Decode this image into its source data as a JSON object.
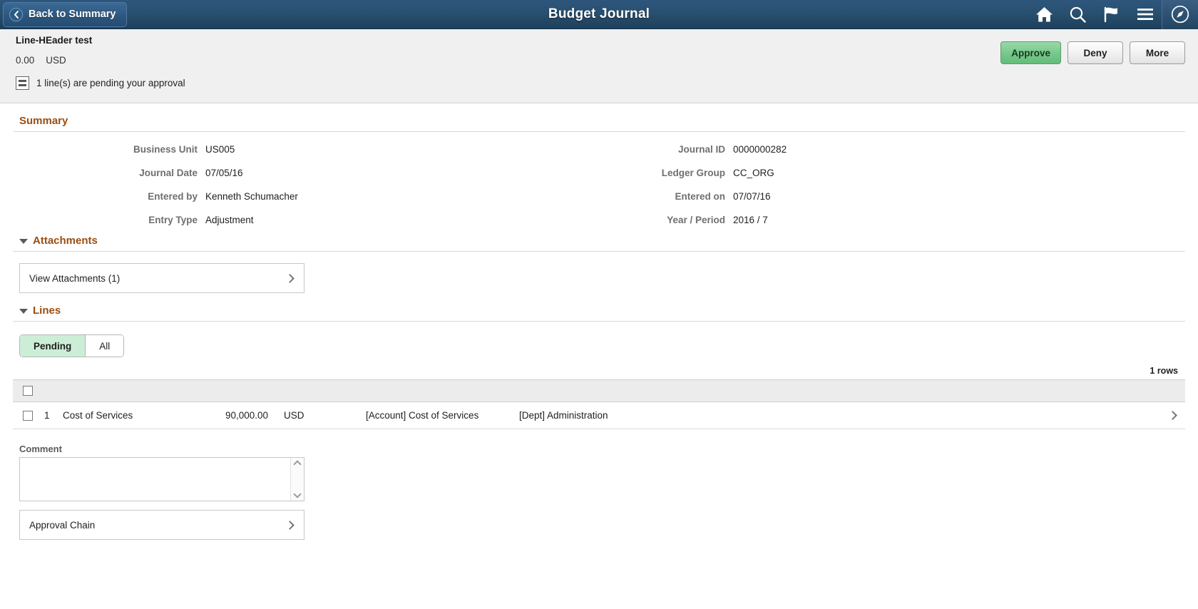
{
  "topbar": {
    "back_label": "Back to Summary",
    "title": "Budget Journal",
    "icons": [
      {
        "name": "home-icon",
        "label": "Home"
      },
      {
        "name": "search-icon",
        "label": "Search"
      },
      {
        "name": "flag-icon",
        "label": "Notifications"
      },
      {
        "name": "hamburger-menu-icon",
        "label": "Actions"
      },
      {
        "name": "navbar-compass-icon",
        "label": "NavBar"
      }
    ],
    "background_color": "#2b5279"
  },
  "subheader": {
    "doc_title": "Line-HEader test",
    "amount": "0.00",
    "currency": "USD",
    "pending_message": "1 line(s) are pending your approval",
    "buttons": {
      "approve": "Approve",
      "deny": "Deny",
      "more": "More"
    },
    "approve_color": "#79c98d"
  },
  "summary": {
    "heading": "Summary",
    "left_fields": [
      {
        "label": "Business Unit",
        "value": "US005"
      },
      {
        "label": "Journal Date",
        "value": "07/05/16"
      },
      {
        "label": "Entered by",
        "value": "Kenneth Schumacher"
      },
      {
        "label": "Entry Type",
        "value": "Adjustment"
      }
    ],
    "right_fields": [
      {
        "label": "Journal ID",
        "value": "0000000282"
      },
      {
        "label": "Ledger Group",
        "value": "CC_ORG"
      },
      {
        "label": "Entered on",
        "value": "07/07/16"
      },
      {
        "label": "Year / Period",
        "value": "2016 / 7"
      }
    ]
  },
  "attachments": {
    "heading": "Attachments",
    "link_label": "View Attachments (1)"
  },
  "lines": {
    "heading": "Lines",
    "tabs": [
      {
        "label": "Pending",
        "active": true
      },
      {
        "label": "All",
        "active": false
      }
    ],
    "rows_count": "1 rows",
    "rows": [
      {
        "num": "1",
        "description": "Cost of Services",
        "amount": "90,000.00",
        "currency": "USD",
        "account": "[Account] Cost of Services",
        "dept": "[Dept] Administration"
      }
    ]
  },
  "comment": {
    "label": "Comment",
    "value": "",
    "placeholder": ""
  },
  "approval_chain": {
    "label": "Approval Chain"
  },
  "theme": {
    "section_heading_color": "#9a4e11",
    "header_gradient_top": "#2e567d",
    "header_gradient_bottom": "#1d3f5b"
  }
}
